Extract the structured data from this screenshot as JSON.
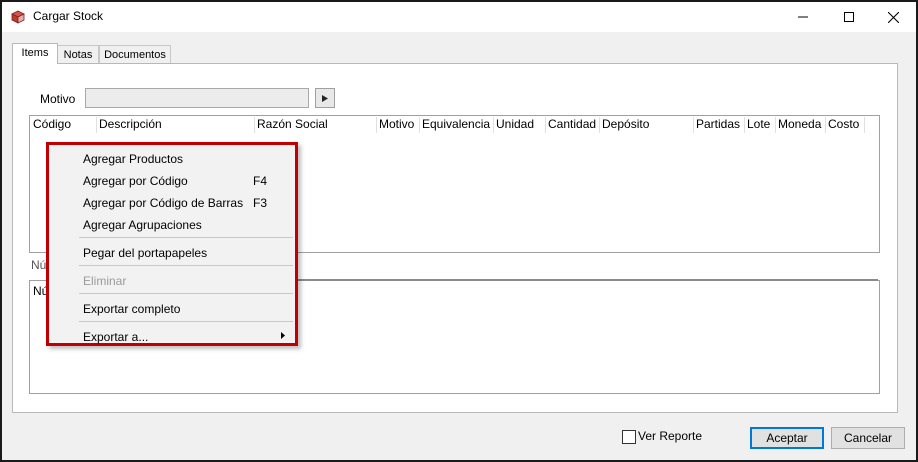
{
  "window": {
    "title": "Cargar Stock",
    "icon": "cube-app-icon",
    "controls": [
      "minimize-icon",
      "maximize-icon",
      "close-icon"
    ]
  },
  "tabs": [
    {
      "label": "Items",
      "active": true
    },
    {
      "label": "Notas",
      "active": false
    },
    {
      "label": "Documentos",
      "active": false
    }
  ],
  "motivo": {
    "label": "Motivo",
    "value": ""
  },
  "items_grid": {
    "columns": [
      "Código",
      "Descripción",
      "Razón Social",
      "Motivo",
      "Equivalencia",
      "Unidad",
      "Cantidad",
      "Depósito",
      "Partidas",
      "Lote",
      "Moneda",
      "Costo"
    ],
    "rows": []
  },
  "lower_section": {
    "label_partial": "Nú",
    "grid_header_partial": "Nú"
  },
  "context_menu": {
    "items": [
      {
        "label": "Agregar Productos",
        "shortcut": "",
        "disabled": false
      },
      {
        "label": "Agregar por Código",
        "shortcut": "F4",
        "disabled": false
      },
      {
        "label": "Agregar por Código de Barras",
        "shortcut": "F3",
        "disabled": false
      },
      {
        "label": "Agregar Agrupaciones",
        "shortcut": "",
        "disabled": false
      },
      {
        "label": "Pegar del portapapeles",
        "shortcut": "",
        "disabled": false
      },
      {
        "label": "Eliminar",
        "shortcut": "",
        "disabled": true
      },
      {
        "label": "Exportar completo",
        "shortcut": "",
        "disabled": false
      },
      {
        "label": "Exportar a...",
        "shortcut": "",
        "disabled": false,
        "submenu": true
      }
    ],
    "highlight_color": "#c00000"
  },
  "footer": {
    "ver_reporte_label": "Ver Reporte",
    "ver_reporte_checked": false,
    "accept_label": "Aceptar",
    "cancel_label": "Cancelar"
  }
}
